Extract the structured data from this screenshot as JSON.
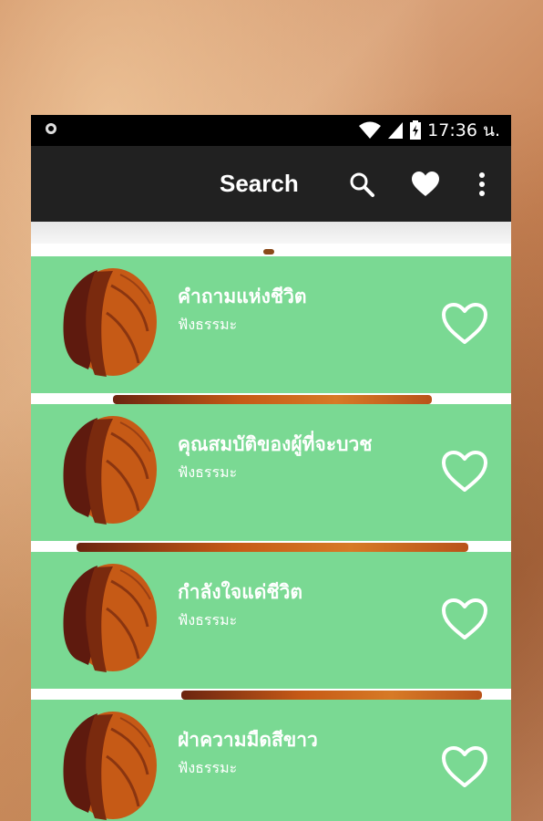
{
  "status_bar": {
    "time": "17:36 น.",
    "icons": [
      "notification-dot-icon",
      "wifi-icon",
      "signal-icon",
      "battery-charging-icon"
    ]
  },
  "toolbar": {
    "title": "Search",
    "icons": [
      "search-icon",
      "heart-icon",
      "more-vert-icon"
    ]
  },
  "colors": {
    "card_background": "#7ad993",
    "toolbar_background": "#212121",
    "status_bar_background": "#000000",
    "robe_orange": "#c65a16",
    "robe_dark": "#5e1a0e"
  },
  "items": [
    {
      "title": "คำถามแห่งชีวิต",
      "subtitle": "ฟังธรรมะ",
      "favorite_icon": "heart-outline-icon"
    },
    {
      "title": "คุณสมบัติของผู้ที่จะบวช",
      "subtitle": "ฟังธรรมะ",
      "favorite_icon": "heart-outline-icon"
    },
    {
      "title": "กำลังใจแด่ชีวิต",
      "subtitle": "ฟังธรรมะ",
      "favorite_icon": "heart-outline-icon"
    },
    {
      "title": "ฝ่าความมืดสีขาว",
      "subtitle": "ฟังธรรมะ",
      "favorite_icon": "heart-outline-icon"
    }
  ]
}
